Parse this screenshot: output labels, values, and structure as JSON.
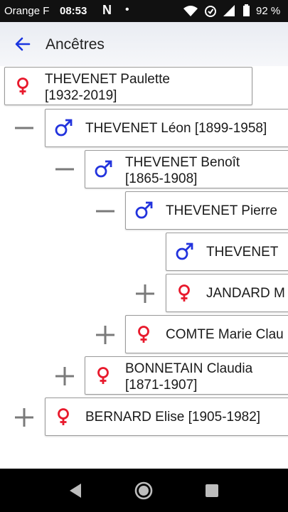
{
  "status": {
    "carrier": "Orange F",
    "time": "08:53",
    "app_glyph": "N",
    "dot": "•",
    "battery": "92 %"
  },
  "header": {
    "title": "Ancêtres"
  },
  "tree": [
    {
      "line1": "THEVENET Paulette",
      "line2": "[1932-2019]",
      "sex": "female"
    },
    {
      "line1": "THEVENET Léon [1899-1958]",
      "sex": "male",
      "toggle": "minus"
    },
    {
      "line1": "THEVENET Benoît",
      "line2": "[1865-1908]",
      "sex": "male",
      "toggle": "minus"
    },
    {
      "line1": "THEVENET Pierre",
      "sex": "male",
      "toggle": "minus"
    },
    {
      "line1": "THEVENET",
      "sex": "male"
    },
    {
      "line1": "JANDARD M",
      "sex": "female",
      "toggle": "plus"
    },
    {
      "line1": "COMTE Marie Clau",
      "sex": "female",
      "toggle": "plus"
    },
    {
      "line1": "BONNETAIN Claudia",
      "line2": "[1871-1907]",
      "sex": "female",
      "toggle": "plus"
    },
    {
      "line1": "BERNARD Elise [1905-1982]",
      "sex": "female",
      "toggle": "plus"
    }
  ],
  "colors": {
    "male": "#2233dd",
    "female": "#e8192c",
    "toggle": "#7a7a7a",
    "back_arrow": "#1a35e0"
  }
}
